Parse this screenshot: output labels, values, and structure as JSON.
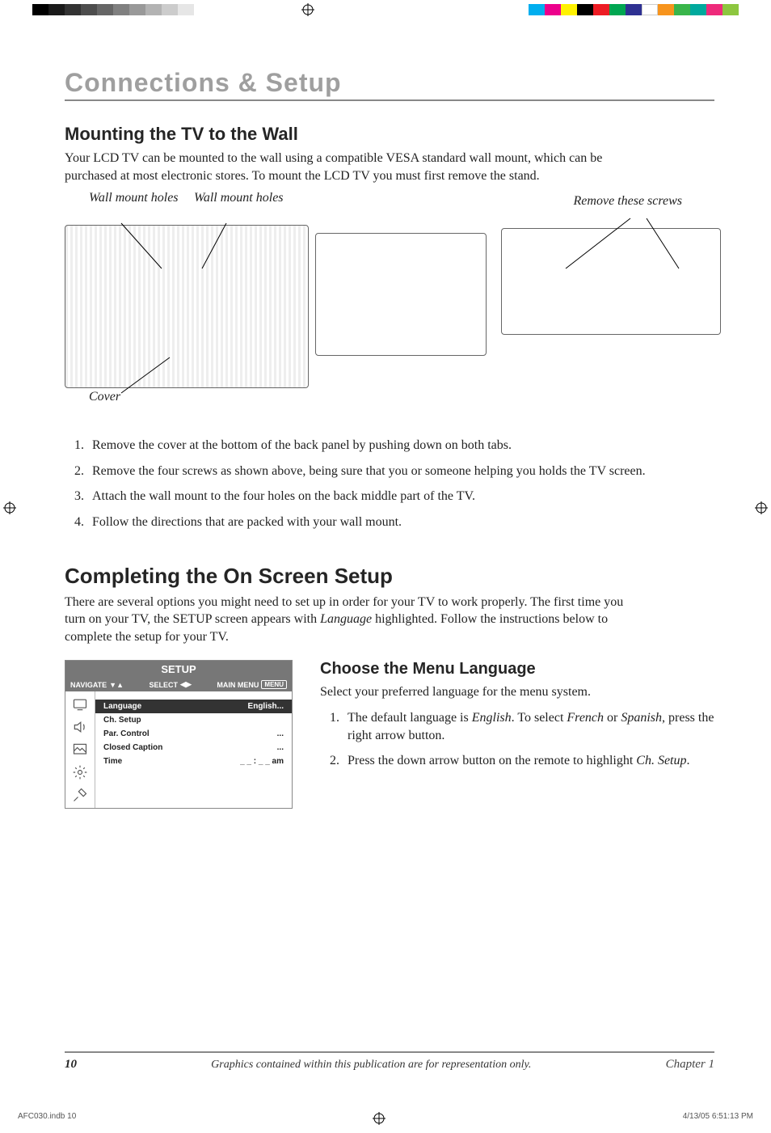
{
  "title": "Connections & Setup",
  "section1": {
    "heading": "Mounting the TV to the Wall",
    "intro": "Your LCD TV can be mounted to the wall using a compatible VESA standard wall mount, which can be purchased at most electronic stores. To mount the LCD TV you must first remove the stand.",
    "callouts": {
      "wmh1": "Wall mount holes",
      "wmh2": "Wall mount holes",
      "remove": "Remove these screws",
      "cover": "Cover"
    },
    "steps": [
      "Remove the cover at the bottom of the back panel by pushing down on both tabs.",
      "Remove the four screws as shown above, being sure that you or someone helping you holds the TV screen.",
      "Attach the wall mount to the four holes on the back middle part of the TV.",
      "Follow the directions that are packed with your wall mount."
    ]
  },
  "section2": {
    "heading": "Completing the On Screen Setup",
    "intro_a": "There are several options you might need to set up in order for your TV to work properly. The first time you turn on your TV, the SETUP screen appears with ",
    "intro_em": "Language",
    "intro_b": " highlighted. Follow the instructions below to complete the setup for your TV."
  },
  "osd": {
    "title": "SETUP",
    "nav": "NAVIGATE",
    "select": "SELECT",
    "mainmenu": "MAIN MENU",
    "menu_pill": "MENU",
    "rows": [
      {
        "label": "Language",
        "value": "English...",
        "selected": true
      },
      {
        "label": "Ch. Setup",
        "value": ""
      },
      {
        "label": "Par. Control",
        "value": "..."
      },
      {
        "label": "Closed Caption",
        "value": "..."
      },
      {
        "label": "Time",
        "value": "_ _ : _ _ am"
      }
    ]
  },
  "section3": {
    "heading": "Choose the Menu Language",
    "intro": "Select your preferred language for the menu system.",
    "step1_a": "The default language is ",
    "step1_em1": "English",
    "step1_b": ". To select ",
    "step1_em2": "French",
    "step1_c": " or ",
    "step1_em3": "Spanish",
    "step1_d": ", press the right arrow button.",
    "step2_a": "Press the down arrow button on the remote to highlight ",
    "step2_em": "Ch. Setup",
    "step2_b": "."
  },
  "footer": {
    "page": "10",
    "center": "Graphics contained within this publication are for representation only.",
    "chapter": "Chapter 1"
  },
  "slug": {
    "file": "AFC030.indb   10",
    "stamp": "4/13/05   6:51:13 PM"
  }
}
